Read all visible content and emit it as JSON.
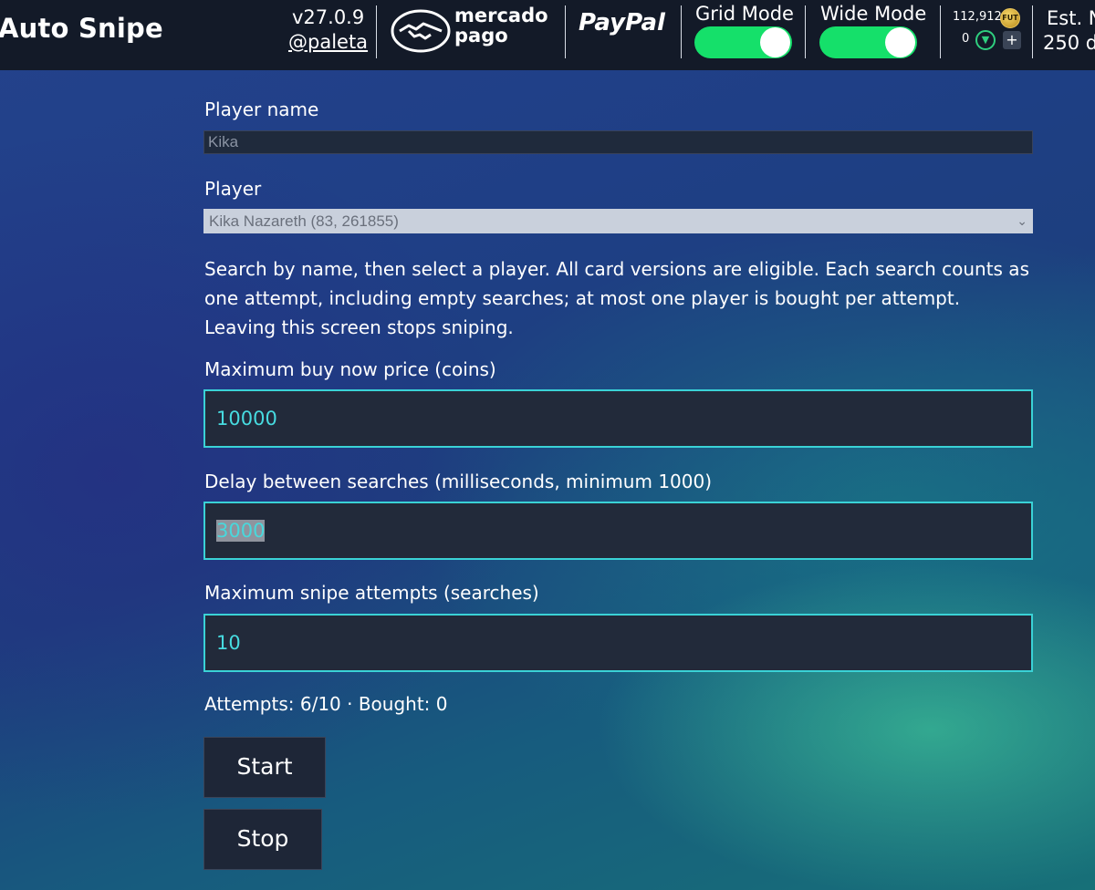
{
  "header": {
    "app_title": "Auto Snipe",
    "version": "v27.0.9",
    "author": "@paleta",
    "mercadopago_line1": "mercado",
    "mercadopago_line2": "pago",
    "paypal": "PayPal",
    "grid_mode_label": "Grid Mode",
    "grid_mode_on": true,
    "wide_mode_label": "Wide Mode",
    "wide_mode_on": true,
    "coins": "112,912",
    "points": "0",
    "est_label": "Est. N",
    "est_value": "250 d"
  },
  "form": {
    "player_name_label": "Player name",
    "player_name_value": "Kika",
    "player_label": "Player",
    "player_selected": "Kika Nazareth (83, 261855)",
    "help_text": "Search by name, then select a player. All card versions are eligible. Each search counts as one attempt, including empty searches; at most one player is bought per attempt. Leaving this screen stops sniping.",
    "max_price_label": "Maximum buy now price (coins)",
    "max_price_value": "10000",
    "delay_label": "Delay between searches (milliseconds, minimum 1000)",
    "delay_value": "3000",
    "max_attempts_label": "Maximum snipe attempts (searches)",
    "max_attempts_value": "10",
    "status": "Attempts: 6/10 · Bought: 0",
    "start_label": "Start",
    "stop_label": "Stop"
  },
  "colors": {
    "header_bg": "#131a28",
    "toggle_on": "#15e06a",
    "input_border": "#3ad2d6",
    "input_text": "#47dbe0"
  }
}
